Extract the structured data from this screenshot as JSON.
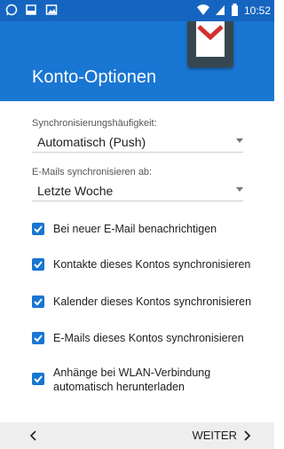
{
  "status_bar": {
    "time": "10:52",
    "icons": [
      "whatsapp-icon",
      "notification-icon",
      "gallery-icon",
      "wifi-icon",
      "signal-icon",
      "battery-icon"
    ]
  },
  "header": {
    "title": "Konto-Optionen",
    "graphic_icon": "gmail-icon"
  },
  "sync_frequency": {
    "label": "Synchronisierungshäufigkeit:",
    "value": "Automatisch (Push)"
  },
  "sync_emails_from": {
    "label": "E-Mails synchronisieren ab:",
    "value": "Letzte Woche"
  },
  "options": [
    {
      "label": "Bei neuer E-Mail benachrichtigen",
      "checked": true
    },
    {
      "label": "Kontakte dieses Kontos synchronisieren",
      "checked": true
    },
    {
      "label": "Kalender dieses Kontos synchronisieren",
      "checked": true
    },
    {
      "label": "E-Mails dieses Kontos synchronisieren",
      "checked": true
    },
    {
      "label_line1": "Anhänge bei WLAN-Verbindung",
      "label_line2": "automatisch herunterladen",
      "checked": true
    }
  ],
  "footer": {
    "next_label": "WEITER"
  },
  "colors": {
    "status_bar": "#1565c0",
    "app_bar": "#1976d2",
    "accent": "#1976d2",
    "footer": "#eeeeee"
  }
}
